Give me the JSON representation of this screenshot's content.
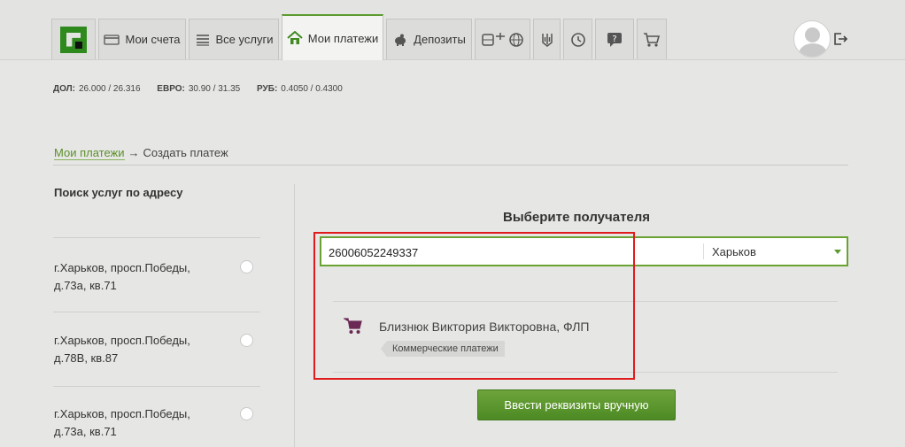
{
  "nav": {
    "tabs": [
      {
        "label": "Мои счета"
      },
      {
        "label": "Все услуги"
      },
      {
        "label": "Мои платежи"
      },
      {
        "label": "Депозиты"
      }
    ]
  },
  "rates": {
    "usd": {
      "name": "ДОЛ:",
      "value": "26.000 / 26.316"
    },
    "eur": {
      "name": "ЕВРО:",
      "value": "30.90 / 31.35"
    },
    "rub": {
      "name": "РУБ:",
      "value": "0.4050 / 0.4300"
    }
  },
  "breadcrumb": {
    "link": "Мои платежи",
    "arrow": "→",
    "current": "Создать платеж"
  },
  "sidebar": {
    "title": "Поиск услуг по адресу",
    "addresses": [
      {
        "line1": "г.Харьков, просп.Победы,",
        "line2": "д.73а, кв.71"
      },
      {
        "line1": "г.Харьков, просп.Победы,",
        "line2": "д.78В, кв.87"
      },
      {
        "line1": "г.Харьков, просп.Победы,",
        "line2": "д.73а, кв.71"
      }
    ]
  },
  "main": {
    "title": "Выберите получателя",
    "search_value": "26006052249337",
    "city": "Харьков",
    "result": {
      "name": "Близнюк Виктория Викторовна, ФЛП",
      "category": "Коммерческие платежи"
    },
    "manual_button": "Ввести реквизиты вручную"
  },
  "colors": {
    "accent_green": "#5c9a2e",
    "highlight_red": "#e01b1b",
    "cart_purple": "#6b2a55"
  }
}
